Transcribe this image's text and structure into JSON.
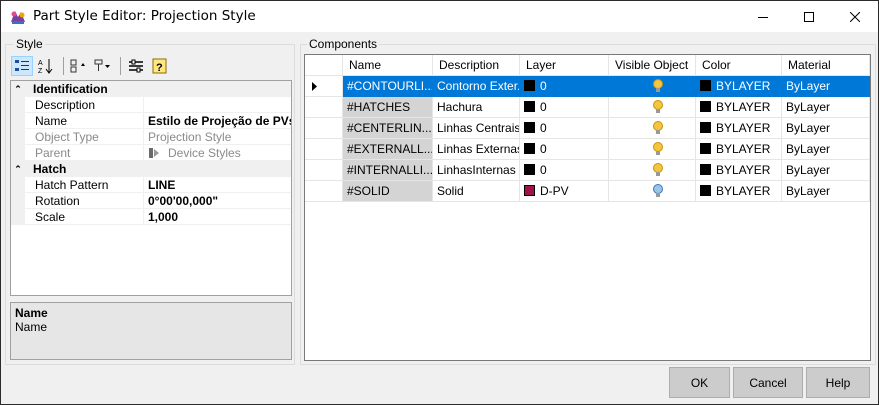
{
  "window": {
    "title": "Part Style Editor: Projection Style"
  },
  "style_panel": {
    "group_label": "Style",
    "categories": [
      {
        "label": "Identification",
        "props": [
          {
            "name": "Description",
            "value": ""
          },
          {
            "name": "Name",
            "value": "Estilo de Projeção de PVs"
          },
          {
            "name": "Object Type",
            "value": "Projection Style"
          },
          {
            "name": "Parent",
            "value": "Device Styles"
          }
        ]
      },
      {
        "label": "Hatch",
        "props": [
          {
            "name": "Hatch Pattern",
            "value": "LINE"
          },
          {
            "name": "Rotation",
            "value": "0°00'00,000\""
          },
          {
            "name": "Scale",
            "value": "1,000"
          }
        ]
      }
    ],
    "help": {
      "title": "Name",
      "text": "Name"
    }
  },
  "components": {
    "group_label": "Components",
    "columns": [
      "Name",
      "Description",
      "Layer",
      "Visible Object",
      "Color",
      "Material"
    ],
    "rows": [
      {
        "name": "#CONTOURLI...",
        "description": "Contorno Exter...",
        "layer": "0",
        "layer_color": "#000000",
        "visible": true,
        "color": "BYLAYER",
        "material": "ByLayer"
      },
      {
        "name": "#HATCHES",
        "description": "Hachura",
        "layer": "0",
        "layer_color": "#000000",
        "visible": true,
        "color": "BYLAYER",
        "material": "ByLayer"
      },
      {
        "name": "#CENTERLIN...",
        "description": "Linhas Centrais",
        "layer": "0",
        "layer_color": "#000000",
        "visible": true,
        "color": "BYLAYER",
        "material": "ByLayer"
      },
      {
        "name": "#EXTERNALL...",
        "description": "Linhas Externas",
        "layer": "0",
        "layer_color": "#000000",
        "visible": true,
        "color": "BYLAYER",
        "material": "ByLayer"
      },
      {
        "name": "#INTERNALLI...",
        "description": "LinhasInternas",
        "layer": "0",
        "layer_color": "#000000",
        "visible": true,
        "color": "BYLAYER",
        "material": "ByLayer"
      },
      {
        "name": "#SOLID",
        "description": "Solid",
        "layer": "D-PV",
        "layer_color": "#a0124a",
        "visible": false,
        "color": "BYLAYER",
        "material": "ByLayer"
      }
    ]
  },
  "buttons": {
    "ok": "OK",
    "cancel": "Cancel",
    "help": "Help"
  },
  "colors": {
    "selection": "#0078d7",
    "bulb_on": "#f5c542",
    "bulb_off": "#6fa8dc"
  }
}
